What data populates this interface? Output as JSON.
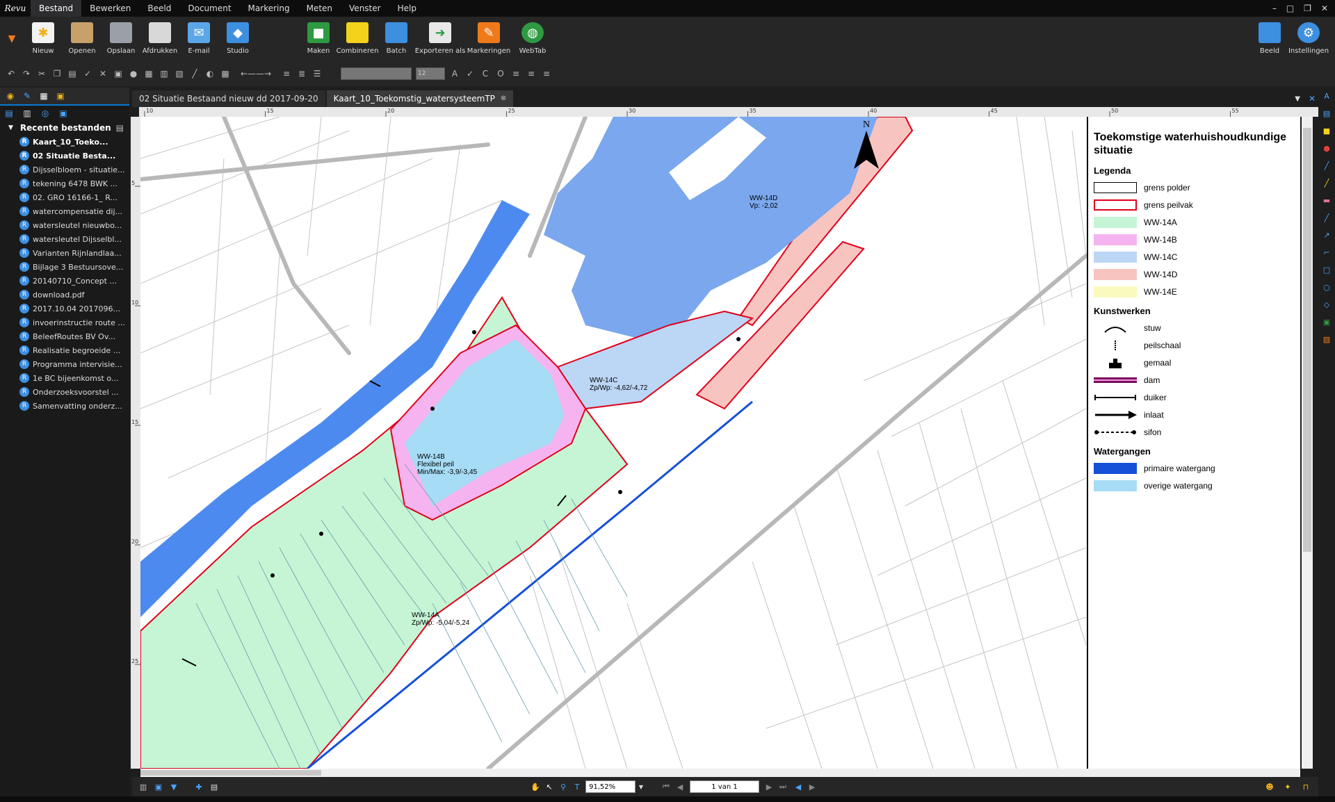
{
  "app": {
    "logo_text": "Revu",
    "window_controls": [
      "–",
      "□",
      "❐",
      "✕"
    ]
  },
  "menu": [
    "Bestand",
    "Bewerken",
    "Beeld",
    "Document",
    "Markering",
    "Meten",
    "Venster",
    "Help"
  ],
  "ribbon": {
    "nieuw": "Nieuw",
    "openen": "Openen",
    "opslaan": "Opslaan",
    "afdrukken": "Afdrukken",
    "email": "E-mail",
    "studio": "Studio",
    "maken": "Maken",
    "combineren": "Combineren",
    "batch": "Batch",
    "exporteren": "Exporteren als",
    "markeringen": "Markeringen",
    "webtab": "WebTab",
    "beeld": "Beeld",
    "instellingen": "Instellingen"
  },
  "toolbar2": {
    "font_size": "12"
  },
  "left_panel": {
    "section_title": "Recente bestanden",
    "items": [
      "Kaart_10_Toeko...",
      "02 Situatie Besta...",
      "Dijsselbloem - situatie...",
      "tekening 6478 BWK ...",
      "02. GRO 16166-1_ R...",
      "watercompensatie dij...",
      "watersleutel nieuwbo...",
      "watersleutel Dijsselbl...",
      "Varianten Rijnlandlaa...",
      "Bijlage 3 Bestuursove...",
      "20140710_Concept ...",
      "download.pdf",
      "2017.10.04 2017096...",
      "invoerinstructie route ...",
      "BeleefRoutes BV Ov...",
      "Realisatie begroeide ...",
      "Programma intervisie...",
      "1e BC bijeenkomst o...",
      "Onderzoeksvoorstel ...",
      "Samenvatting onderz..."
    ]
  },
  "doc_tabs": [
    "02 Situatie Bestaand nieuw dd 2017-09-20",
    "Kaart_10_Toekomstig_watersysteemTP"
  ],
  "ruler_top": [
    "10",
    "15",
    "20",
    "25",
    "30",
    "35",
    "40",
    "45",
    "50",
    "55"
  ],
  "ruler_left": [
    "5",
    "10",
    "15",
    "20",
    "25"
  ],
  "map": {
    "north": "N",
    "labels": {
      "ww14d": "WW-14D\nVp: -2,02",
      "ww14c": "WW-14C\nZp/Wp: -4,62/-4,72",
      "ww14b": "WW-14B\nFlexibel peil\nMin/Max: -3,9/-3,45",
      "ww14a": "WW-14A\nZp/Wp: -5,04/-5,24"
    }
  },
  "legend": {
    "title": "Toekomstige waterhuishoudkundige situatie",
    "legenda": "Legenda",
    "polder": "grens polder",
    "peilvak": "grens peilvak",
    "a": "WW-14A",
    "b": "WW-14B",
    "c": "WW-14C",
    "d": "WW-14D",
    "e": "WW-14E",
    "kunstwerken": "Kunstwerken",
    "stuw": "stuw",
    "peilschaal": "peilschaal",
    "gemaal": "gemaal",
    "dam": "dam",
    "duiker": "duiker",
    "inlaat": "inlaat",
    "sifon": "sifon",
    "watergangen": "Watergangen",
    "primair": "primaire watergang",
    "overig": "overige watergang",
    "colors": {
      "a": "#c5f5d5",
      "b": "#f5b4f0",
      "c": "#bcd6f5",
      "d": "#f8c4c0",
      "e": "#fafabf",
      "primair": "#1450d8",
      "overig": "#a6dcf5",
      "peilvak": "#e0001a"
    }
  },
  "status": {
    "zoom": "91,52%",
    "page": "1 van 1"
  }
}
